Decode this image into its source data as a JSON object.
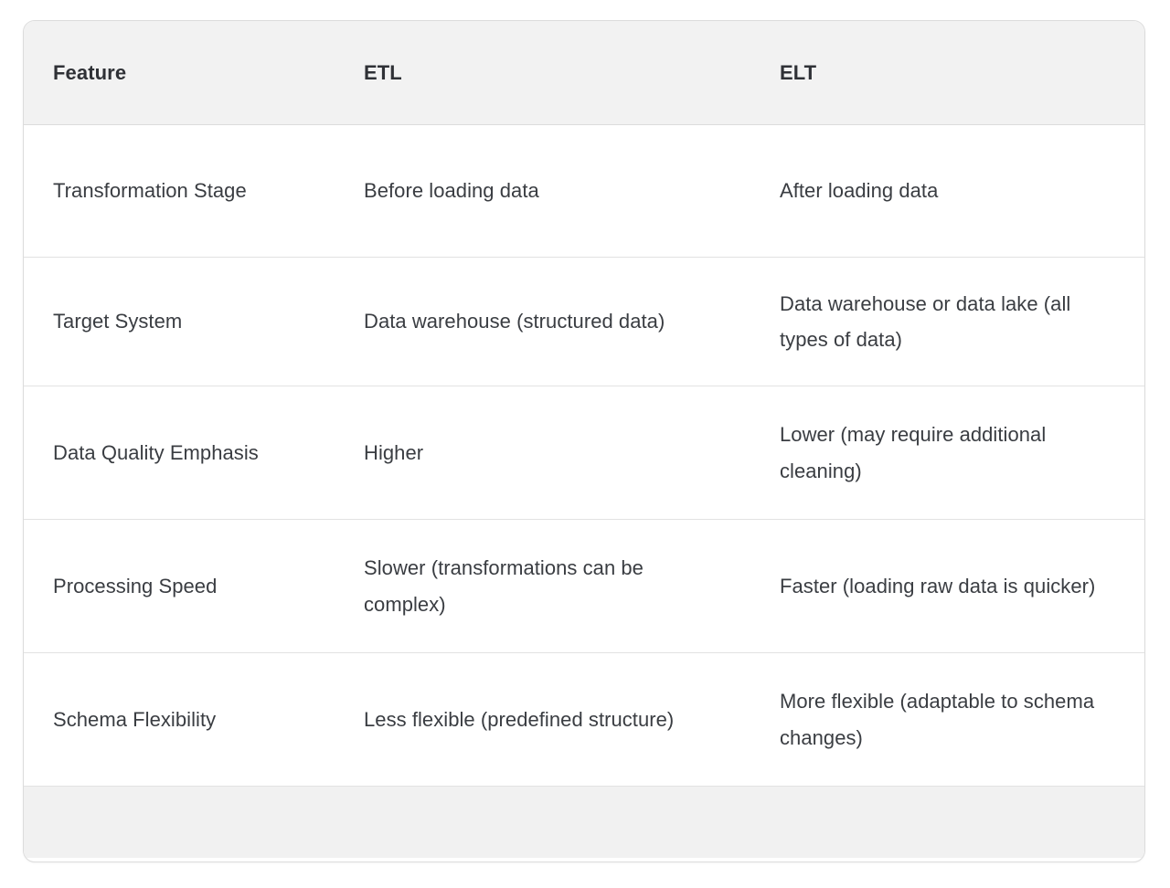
{
  "table": {
    "name": "etl-vs-elt-comparison-table",
    "columns": [
      {
        "key": "feature",
        "label": "Feature"
      },
      {
        "key": "etl",
        "label": "ETL"
      },
      {
        "key": "elt",
        "label": "ELT"
      }
    ],
    "rows": [
      {
        "feature": "Transformation Stage",
        "etl": "Before loading data",
        "elt": "After loading data"
      },
      {
        "feature": "Target System",
        "etl": "Data warehouse (structured data)",
        "elt": "Data warehouse or data lake (all types of data)"
      },
      {
        "feature": "Data Quality Emphasis",
        "etl": "Higher",
        "elt": "Lower (may require additional cleaning)"
      },
      {
        "feature": "Processing Speed",
        "etl": "Slower (transformations can be complex)",
        "elt": "Faster (loading raw data is quicker)"
      },
      {
        "feature": "Schema Flexibility",
        "etl": "Less flexible (predefined structure)",
        "elt": "More flexible (adaptable to schema changes)"
      }
    ],
    "footer": {
      "label": ""
    },
    "colors": {
      "page_background": "#ffffff",
      "card_background": "#ffffff",
      "header_background": "#f2f2f2",
      "footer_background": "#f1f1f1",
      "border": "#dcdcdc",
      "row_divider": "#e2e2e2",
      "header_text": "#2f3136",
      "body_text": "#3a3d42"
    }
  }
}
